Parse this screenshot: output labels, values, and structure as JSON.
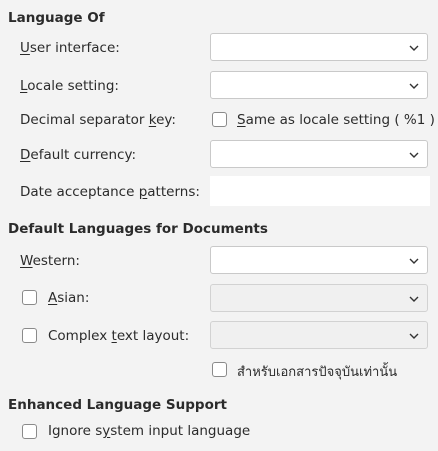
{
  "language_of": {
    "heading": "Language Of",
    "user_interface": {
      "label_pre": "",
      "label_u": "U",
      "label_post": "ser interface:",
      "value": ""
    },
    "locale_setting": {
      "label_pre": "",
      "label_u": "L",
      "label_post": "ocale setting:",
      "value": ""
    },
    "decimal_separator": {
      "label_pre": "Decimal separator ",
      "label_u": "k",
      "label_post": "ey:",
      "checkbox_u": "S",
      "checkbox_post": "ame as locale setting ( %1 )",
      "checked": false
    },
    "default_currency": {
      "label_pre": "",
      "label_u": "D",
      "label_post": "efault currency:",
      "value": ""
    },
    "date_patterns": {
      "label_pre": "Date acceptance ",
      "label_u": "p",
      "label_post": "atterns:",
      "value": ""
    }
  },
  "default_languages": {
    "heading": "Default Languages for Documents",
    "western": {
      "label_pre": "",
      "label_u": "W",
      "label_post": "estern:",
      "value": ""
    },
    "asian": {
      "label_pre": "",
      "label_u": "A",
      "label_post": "sian:",
      "checked": false,
      "value": ""
    },
    "ctl": {
      "label_pre": "Complex ",
      "label_u": "t",
      "label_post": "ext layout:",
      "checked": false,
      "value": ""
    },
    "current_doc_only": {
      "label": "สำหรับเอกสารปัจจุบันเท่านั้น",
      "checked": false
    }
  },
  "enhanced": {
    "heading": "Enhanced Language Support",
    "ignore_input": {
      "label_pre": "Ignore s",
      "label_u": "y",
      "label_post": "stem input language",
      "checked": false
    }
  },
  "icons": {
    "dropdown": "chevron-down-icon"
  },
  "colors": {
    "background": "#f3f3f3",
    "field": "#ffffff",
    "border": "#c9c9c9"
  }
}
